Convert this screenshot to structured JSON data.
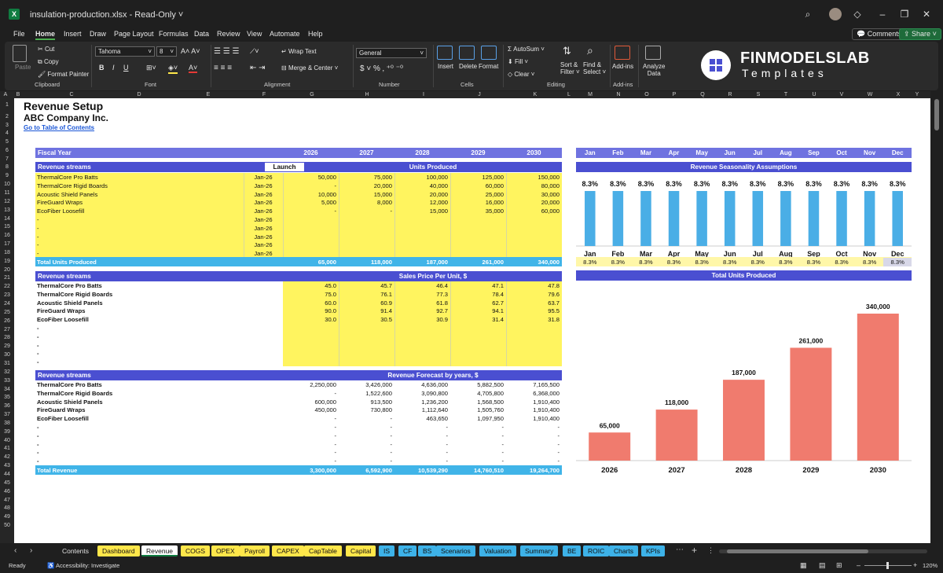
{
  "window": {
    "title": "insulation-production.xlsx  -  Read-Only ˅"
  },
  "menu": [
    "File",
    "Home",
    "Insert",
    "Draw",
    "Page Layout",
    "Formulas",
    "Data",
    "Review",
    "View",
    "Automate",
    "Help"
  ],
  "menu_active": "Home",
  "header_buttons": {
    "comments": "Comments",
    "share": "Share"
  },
  "ribbon": {
    "clipboard": {
      "paste": "Paste",
      "cut": "Cut",
      "copy": "Copy",
      "format_painter": "Format Painter",
      "group": "Clipboard"
    },
    "font": {
      "name": "Tahoma",
      "size": "8",
      "group": "Font"
    },
    "alignment": {
      "wrap": "Wrap Text",
      "merge": "Merge & Center",
      "group": "Alignment"
    },
    "number": {
      "format": "General",
      "group": "Number"
    },
    "cells": {
      "insert": "Insert",
      "delete": "Delete",
      "format": "Format",
      "group": "Cells"
    },
    "editing": {
      "autosum": "AutoSum",
      "fill": "Fill",
      "clear": "Clear",
      "sort": "Sort &",
      "filter": "Filter",
      "find": "Find &",
      "select": "Select",
      "group": "Editing"
    },
    "addins": {
      "label": "Add-ins",
      "group": "Add-ins"
    },
    "analyze": {
      "l1": "Analyze",
      "l2": "Data"
    }
  },
  "brand": {
    "name": "FINMODELSLAB",
    "sub": "Templates"
  },
  "columns": [
    "A",
    "B",
    "C",
    "D",
    "E",
    "F",
    "G",
    "H",
    "I",
    "J",
    "K",
    "L",
    "M",
    "N",
    "O",
    "P",
    "Q",
    "R",
    "S",
    "T",
    "U",
    "V",
    "W",
    "X",
    "Y"
  ],
  "sheet": {
    "title": "Revenue Setup",
    "company": "ABC Company Inc.",
    "link": "Go to Table of Contents",
    "fiscal_year_label": "Fiscal Year",
    "years": [
      "2026",
      "2027",
      "2028",
      "2029",
      "2030"
    ],
    "months": [
      "Jan",
      "Feb",
      "Mar",
      "Apr",
      "May",
      "Jun",
      "Jul",
      "Aug",
      "Sep",
      "Oct",
      "Nov",
      "Dec"
    ],
    "units": {
      "streams_label": "Revenue streams",
      "launch_label": "Launch",
      "section_label": "Units Produced",
      "rows": [
        {
          "name": "ThermalCore Pro Batts",
          "launch": "Jan-26",
          "v": [
            "50,000",
            "75,000",
            "100,000",
            "125,000",
            "150,000"
          ]
        },
        {
          "name": "ThermalCore Rigid Boards",
          "launch": "Jan-26",
          "v": [
            "-",
            "20,000",
            "40,000",
            "60,000",
            "80,000"
          ]
        },
        {
          "name": "Acoustic Shield Panels",
          "launch": "Jan-26",
          "v": [
            "10,000",
            "15,000",
            "20,000",
            "25,000",
            "30,000"
          ]
        },
        {
          "name": "FireGuard Wraps",
          "launch": "Jan-26",
          "v": [
            "5,000",
            "8,000",
            "12,000",
            "16,000",
            "20,000"
          ]
        },
        {
          "name": "EcoFiber Loosefill",
          "launch": "Jan-26",
          "v": [
            "-",
            "-",
            "15,000",
            "35,000",
            "60,000"
          ]
        },
        {
          "name": "-",
          "launch": "Jan-26",
          "v": [
            "",
            "",
            "",
            "",
            ""
          ]
        },
        {
          "name": "-",
          "launch": "Jan-26",
          "v": [
            "",
            "",
            "",
            "",
            ""
          ]
        },
        {
          "name": "-",
          "launch": "Jan-26",
          "v": [
            "",
            "",
            "",
            "",
            ""
          ]
        },
        {
          "name": "-",
          "launch": "Jan-26",
          "v": [
            "",
            "",
            "",
            "",
            ""
          ]
        },
        {
          "name": "-",
          "launch": "Jan-26",
          "v": [
            "",
            "",
            "",
            "",
            ""
          ]
        }
      ],
      "total_label": "Total Units Produced",
      "totals": [
        "65,000",
        "118,000",
        "187,000",
        "261,000",
        "340,000"
      ]
    },
    "price": {
      "streams_label": "Revenue streams",
      "section_label": "Sales Price Per Unit, $",
      "rows": [
        {
          "name": "ThermalCore Pro Batts",
          "v": [
            "45.0",
            "45.7",
            "46.4",
            "47.1",
            "47.8"
          ]
        },
        {
          "name": "ThermalCore Rigid Boards",
          "v": [
            "75.0",
            "76.1",
            "77.3",
            "78.4",
            "79.6"
          ]
        },
        {
          "name": "Acoustic Shield Panels",
          "v": [
            "60.0",
            "60.9",
            "61.8",
            "62.7",
            "63.7"
          ]
        },
        {
          "name": "FireGuard Wraps",
          "v": [
            "90.0",
            "91.4",
            "92.7",
            "94.1",
            "95.5"
          ]
        },
        {
          "name": "EcoFiber Loosefill",
          "v": [
            "30.0",
            "30.5",
            "30.9",
            "31.4",
            "31.8"
          ]
        },
        {
          "name": "-",
          "v": [
            "",
            "",
            "",
            "",
            ""
          ]
        },
        {
          "name": "-",
          "v": [
            "",
            "",
            "",
            "",
            ""
          ]
        },
        {
          "name": "-",
          "v": [
            "",
            "",
            "",
            "",
            ""
          ]
        },
        {
          "name": "-",
          "v": [
            "",
            "",
            "",
            "",
            ""
          ]
        },
        {
          "name": "-",
          "v": [
            "",
            "",
            "",
            "",
            ""
          ]
        }
      ]
    },
    "revenue": {
      "streams_label": "Revenue streams",
      "section_label": "Revenue Forecast by years, $",
      "rows": [
        {
          "name": "ThermalCore Pro Batts",
          "v": [
            "2,250,000",
            "3,426,000",
            "4,636,000",
            "5,882,500",
            "7,165,500"
          ]
        },
        {
          "name": "ThermalCore Rigid Boards",
          "v": [
            "-",
            "1,522,600",
            "3,090,800",
            "4,705,800",
            "6,368,000"
          ]
        },
        {
          "name": "Acoustic Shield Panels",
          "v": [
            "600,000",
            "913,500",
            "1,236,200",
            "1,568,500",
            "1,910,400"
          ]
        },
        {
          "name": "FireGuard Wraps",
          "v": [
            "450,000",
            "730,800",
            "1,112,640",
            "1,505,760",
            "1,910,400"
          ]
        },
        {
          "name": "EcoFiber Loosefill",
          "v": [
            "-",
            "-",
            "463,650",
            "1,097,950",
            "1,910,400"
          ]
        },
        {
          "name": "-",
          "v": [
            "-",
            "-",
            "-",
            "-",
            "-"
          ]
        },
        {
          "name": "-",
          "v": [
            "-",
            "-",
            "-",
            "-",
            "-"
          ]
        },
        {
          "name": "-",
          "v": [
            "-",
            "-",
            "-",
            "-",
            "-"
          ]
        },
        {
          "name": "-",
          "v": [
            "-",
            "-",
            "-",
            "-",
            "-"
          ]
        },
        {
          "name": "-",
          "v": [
            "-",
            "-",
            "-",
            "-",
            "-"
          ]
        }
      ],
      "total_label": "Total Revenue",
      "totals": [
        "3,300,000",
        "6,592,900",
        "10,539,290",
        "14,760,510",
        "19,264,700"
      ]
    },
    "seasonality": {
      "section_label": "Revenue Seasonality Assumptions",
      "labels": [
        "8.3%",
        "8.3%",
        "8.3%",
        "8.3%",
        "8.3%",
        "8.3%",
        "8.3%",
        "8.3%",
        "8.3%",
        "8.3%",
        "8.3%",
        "8.3%"
      ]
    },
    "units_chart_title": "Total Units Produced"
  },
  "chart_data": [
    {
      "type": "bar",
      "title": "Revenue Seasonality Assumptions",
      "categories": [
        "Jan",
        "Feb",
        "Mar",
        "Apr",
        "May",
        "Jun",
        "Jul",
        "Aug",
        "Sep",
        "Oct",
        "Nov",
        "Dec"
      ],
      "values": [
        8.3,
        8.3,
        8.3,
        8.3,
        8.3,
        8.3,
        8.3,
        8.3,
        8.3,
        8.3,
        8.3,
        8.3
      ],
      "data_labels": [
        "8.3%",
        "8.3%",
        "8.3%",
        "8.3%",
        "8.3%",
        "8.3%",
        "8.3%",
        "8.3%",
        "8.3%",
        "8.3%",
        "8.3%",
        "8.3%"
      ],
      "color": "#4aaee6",
      "ylim": [
        0,
        8.3
      ],
      "grid": false
    },
    {
      "type": "bar",
      "title": "Total Units Produced",
      "categories": [
        "2026",
        "2027",
        "2028",
        "2029",
        "2030"
      ],
      "values": [
        65000,
        118000,
        187000,
        261000,
        340000
      ],
      "data_labels": [
        "65,000",
        "118,000",
        "187,000",
        "261,000",
        "340,000"
      ],
      "color": "#f07b6e",
      "ylim": [
        0,
        340000
      ],
      "grid": false
    }
  ],
  "sheet_tabs": [
    {
      "label": "Contents",
      "style": "plain"
    },
    {
      "label": "Dashboard",
      "style": "y"
    },
    {
      "label": "Revenue",
      "style": "active"
    },
    {
      "label": "COGS",
      "style": "y"
    },
    {
      "label": "OPEX",
      "style": "y"
    },
    {
      "label": "Payroll",
      "style": "y"
    },
    {
      "label": "CAPEX",
      "style": "y"
    },
    {
      "label": "CapTable",
      "style": "y"
    },
    {
      "label": "Capital",
      "style": "y"
    },
    {
      "label": "IS",
      "style": "b"
    },
    {
      "label": "CF",
      "style": "b"
    },
    {
      "label": "BS",
      "style": "b"
    },
    {
      "label": "Scenarios",
      "style": "b"
    },
    {
      "label": "Valuation",
      "style": "b"
    },
    {
      "label": "Summary",
      "style": "b"
    },
    {
      "label": "BE",
      "style": "b"
    },
    {
      "label": "ROIC",
      "style": "b"
    },
    {
      "label": "Charts",
      "style": "b"
    },
    {
      "label": "KPIs",
      "style": "b"
    }
  ],
  "status": {
    "ready": "Ready",
    "accessibility": "Accessibility: Investigate",
    "zoom": "120%"
  }
}
